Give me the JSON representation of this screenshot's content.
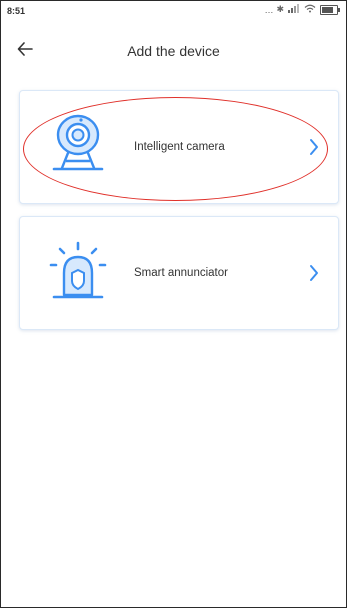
{
  "status_bar": {
    "time": "8:51",
    "icons": [
      "signal-dots-icon",
      "bluetooth-icon",
      "wifi-icon",
      "battery-icon"
    ],
    "indicator_text": "... ✱ ♫ .ıl ⌔"
  },
  "header": {
    "back_icon": "back-arrow-icon",
    "title": "Add the device"
  },
  "devices": [
    {
      "label": "Intelligent camera",
      "icon": "camera-icon"
    },
    {
      "label": "Smart annunciator",
      "icon": "alarm-siren-icon"
    }
  ],
  "colors": {
    "accent": "#3b8ef0",
    "card_border": "#dbe8f7",
    "annotation": "#e0302a"
  }
}
